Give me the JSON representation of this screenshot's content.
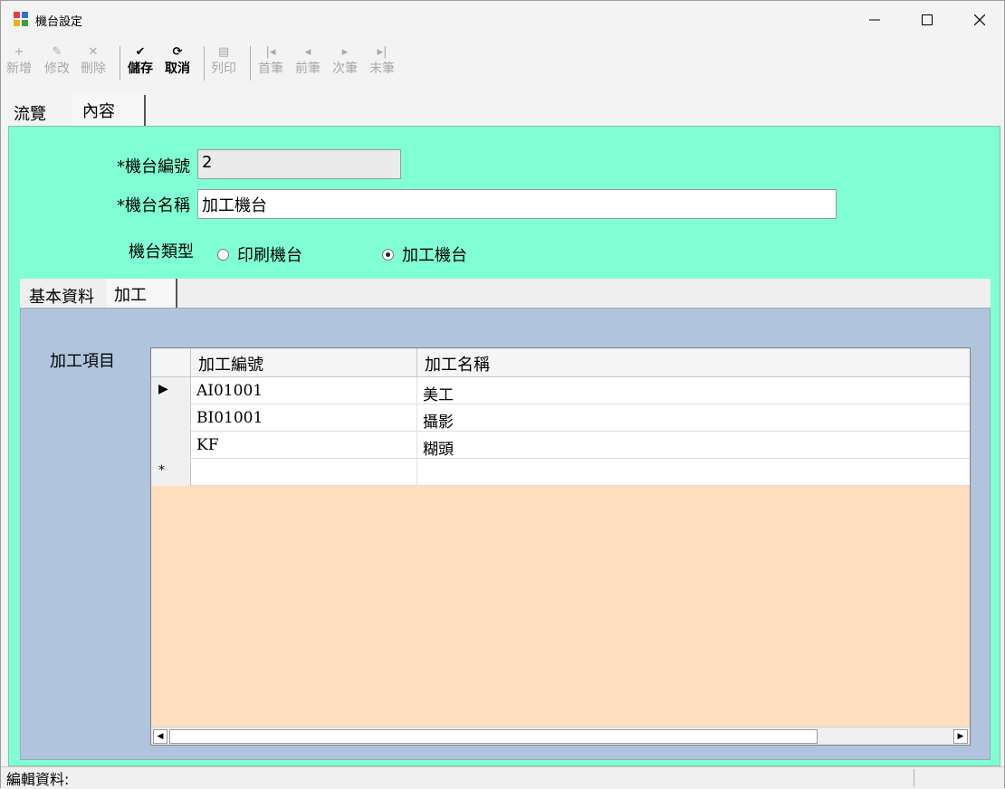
{
  "window": {
    "title": "機台設定"
  },
  "toolbar": {
    "items": [
      {
        "icon": "+",
        "label": "新增",
        "active": false
      },
      {
        "icon": "✎",
        "label": "修改",
        "active": false
      },
      {
        "icon": "✕",
        "label": "刪除",
        "active": false
      },
      {
        "icon": "✔",
        "label": "儲存",
        "active": true
      },
      {
        "icon": "⟳",
        "label": "取消",
        "active": true
      },
      {
        "icon": "▤",
        "label": "列印",
        "active": false
      },
      {
        "icon": "|◂",
        "label": "首筆",
        "active": false
      },
      {
        "icon": "◂",
        "label": "前筆",
        "active": false
      },
      {
        "icon": "▸",
        "label": "次筆",
        "active": false
      },
      {
        "icon": "▸|",
        "label": "末筆",
        "active": false
      }
    ]
  },
  "tabs": {
    "browse": "流覽",
    "content": "內容"
  },
  "form": {
    "machine_no_label": "*機台編號",
    "machine_no_value": "2",
    "machine_name_label": "*機台名稱",
    "machine_name_value": "加工機台",
    "machine_type_label": "機台類型",
    "type_options": [
      {
        "label": "印刷機台",
        "checked": false
      },
      {
        "label": "加工機台",
        "checked": true
      }
    ]
  },
  "inner_tabs": {
    "basic": "基本資料",
    "process": "加工"
  },
  "grid": {
    "label": "加工項目",
    "columns": [
      "加工編號",
      "加工名稱"
    ],
    "rows": [
      {
        "marker": "▶",
        "code": "AI01001",
        "name": "美工"
      },
      {
        "marker": "",
        "code": "BI01001",
        "name": "攝影"
      },
      {
        "marker": "",
        "code": "KF",
        "name": "糊頭"
      },
      {
        "marker": "*",
        "code": "",
        "name": ""
      }
    ]
  },
  "status": {
    "text": "編輯資料:"
  },
  "colors": {
    "form_bg": "#80ffd4",
    "panel_bg": "#b0c4de",
    "grid_bg": "#ffdec0"
  }
}
